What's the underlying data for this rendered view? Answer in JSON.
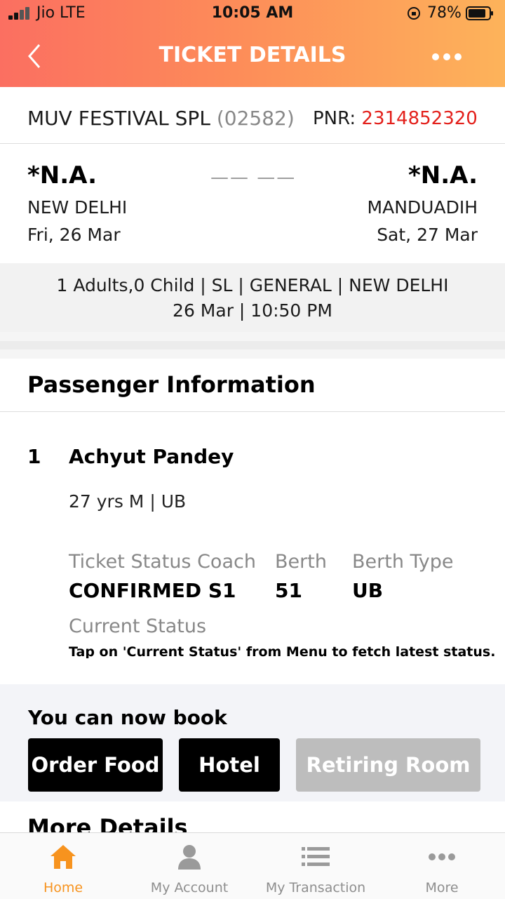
{
  "status_bar": {
    "carrier": "Jio  LTE",
    "time": "10:05 AM",
    "battery": "78%"
  },
  "nav": {
    "title": "TICKET DETAILS",
    "back_icon": "chevron-left-icon",
    "more_icon": "more-dots-icon"
  },
  "train": {
    "name": "MUV FESTIVAL SPL",
    "number": "(02582)",
    "pnr_label": "PNR:",
    "pnr": "2314852320"
  },
  "journey": {
    "from": {
      "code": "*N.A.",
      "station": "NEW DELHI",
      "date": "Fri, 26 Mar"
    },
    "to": {
      "code": "*N.A.",
      "station": "MANDUADIH",
      "date": "Sat, 27 Mar"
    },
    "duration": "—— ——"
  },
  "summary": {
    "line1": "1 Adults,0 Child | SL | GENERAL | NEW DELHI",
    "line2": "26 Mar | 10:50 PM"
  },
  "passenger_section": {
    "title": "Passenger Information",
    "passenger": {
      "index": "1",
      "name": "Achyut Pandey",
      "meta": "27 yrs M | UB",
      "labels": {
        "status_coach": "Ticket Status Coach",
        "berth": "Berth",
        "berth_type": "Berth Type"
      },
      "values": {
        "status_coach": "CONFIRMED S1",
        "berth": "51",
        "berth_type": "UB"
      },
      "current_status_label": "Current Status",
      "current_status_note": "Tap on 'Current Status' from Menu to fetch latest status."
    }
  },
  "book": {
    "title": "You can now book",
    "buttons": {
      "food": "Order Food",
      "hotel": "Hotel",
      "room": "Retiring Room"
    }
  },
  "more_details": "More Details",
  "tabbar": {
    "items": [
      {
        "label": "Home",
        "icon": "home-icon",
        "active": true
      },
      {
        "label": "My Account",
        "icon": "user-icon",
        "active": false
      },
      {
        "label": "My Transaction",
        "icon": "list-icon",
        "active": false
      },
      {
        "label": "More",
        "icon": "more-dots-icon",
        "active": false
      }
    ]
  },
  "colors": {
    "accent": "#f7931e",
    "pnr": "#e3201b",
    "header_start": "#fb6f61",
    "header_end": "#fdb35a"
  }
}
